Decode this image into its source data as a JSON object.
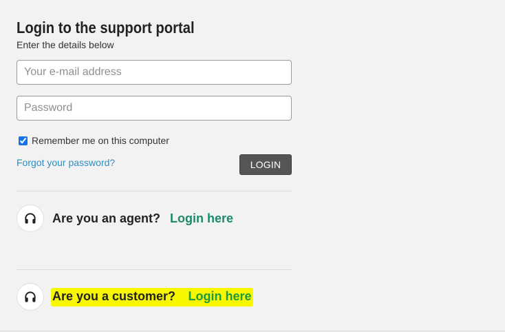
{
  "header": {
    "title": "Login to the support portal",
    "subtitle": "Enter the details below"
  },
  "form": {
    "email": {
      "placeholder": "Your e-mail address",
      "value": ""
    },
    "password": {
      "placeholder": "Password",
      "value": ""
    },
    "remember": {
      "label": "Remember me on this computer",
      "checked": true
    },
    "forgot_label": "Forgot your password?",
    "login_label": "LOGIN"
  },
  "roles": [
    {
      "question": "Are you an agent?",
      "link_label": "Login here",
      "icon": "headset-icon"
    },
    {
      "question": "Are you a customer?",
      "link_label": "Login here",
      "icon": "headset-icon",
      "highlighted": true
    }
  ],
  "colors": {
    "background": "#f2f2f2",
    "link": "#2b8fc7",
    "agent_link": "#1d8a6b",
    "customer_link": "#1f9a3c",
    "button": "#555555",
    "highlight": "#f7f700"
  }
}
